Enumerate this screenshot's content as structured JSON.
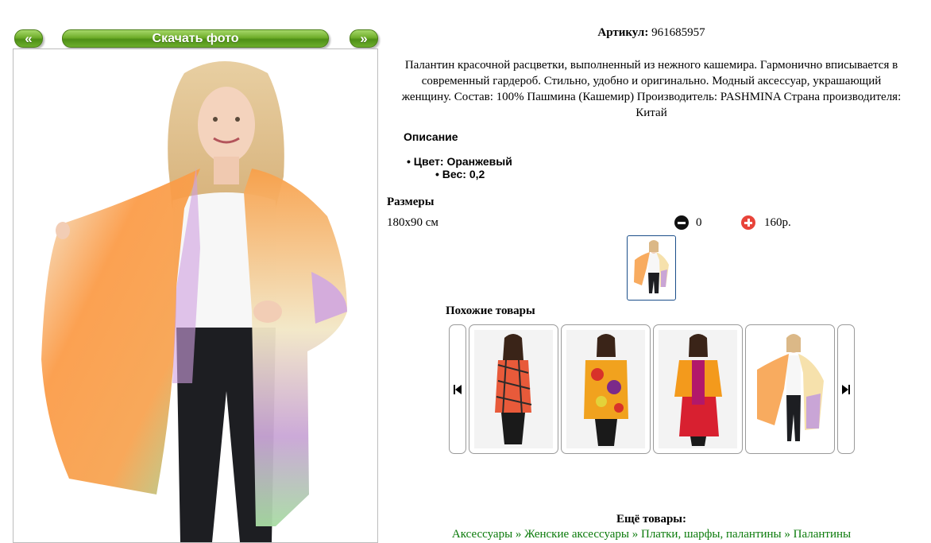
{
  "nav": {
    "prev_label": "«",
    "download_label": "Скачать фото",
    "next_label": "»"
  },
  "product": {
    "article_label": "Артикул:",
    "article_value": "961685957",
    "description_lines": [
      "Палантин красочной расцветки, выполненный из нежного кашемира. Гармонично вписывается в",
      "современный гардероб. Стильно, удобно и оригинально. Модный аксессуар, украшающий",
      "женщину. Состав: 100% Пашмина (Кашемир) Производитель: PASHMINA Страна производителя:",
      "Китай"
    ],
    "details_heading": "Описание",
    "color_item": "Цвет: Оранжевый",
    "weight_item": "Вес: 0,2"
  },
  "sizes": {
    "heading": "Размеры",
    "size": "180x90 см",
    "quantity": "0",
    "price": "160р."
  },
  "similar": {
    "heading": "Похожие товары"
  },
  "more": {
    "heading": "Ещё товары:",
    "links_text": "Аксессуары » Женские аксессуары » Платки, шарфы, палантины » Палантины"
  },
  "colors": {
    "button_green": "#6fae2a",
    "link_green": "#0a7a0a",
    "minus_icon": "#111111",
    "plus_icon": "#e8443a"
  }
}
